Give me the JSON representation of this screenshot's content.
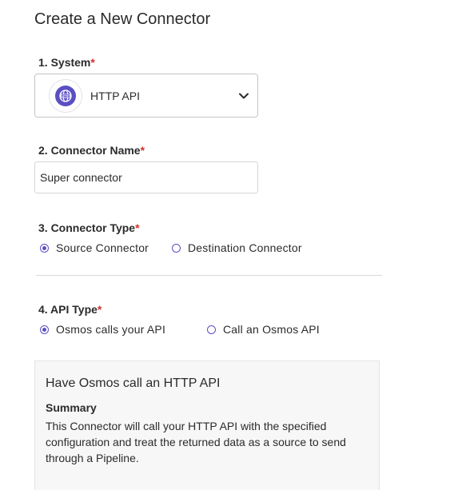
{
  "page": {
    "title": "Create a New Connector"
  },
  "system": {
    "label": "1. System",
    "required_mark": "*",
    "selected_value": "HTTP API",
    "icon": "globe-icon"
  },
  "connector_name": {
    "label": "2. Connector Name",
    "required_mark": "*",
    "value": "Super connector"
  },
  "connector_type": {
    "label": "3. Connector Type",
    "required_mark": "*",
    "options": [
      {
        "label": "Source Connector",
        "checked": true
      },
      {
        "label": "Destination Connector",
        "checked": false
      }
    ]
  },
  "api_type": {
    "label": "4. API Type",
    "required_mark": "*",
    "options": [
      {
        "label": "Osmos calls your API",
        "checked": true
      },
      {
        "label": "Call an Osmos API",
        "checked": false
      }
    ]
  },
  "info": {
    "title": "Have Osmos call an HTTP API",
    "subtitle": "Summary",
    "description": "This Connector will call your HTTP API with the specified configuration and treat the returned data as a source to send through a Pipeline."
  },
  "colors": {
    "accent": "#5b4fc4",
    "required": "#d0312d"
  }
}
